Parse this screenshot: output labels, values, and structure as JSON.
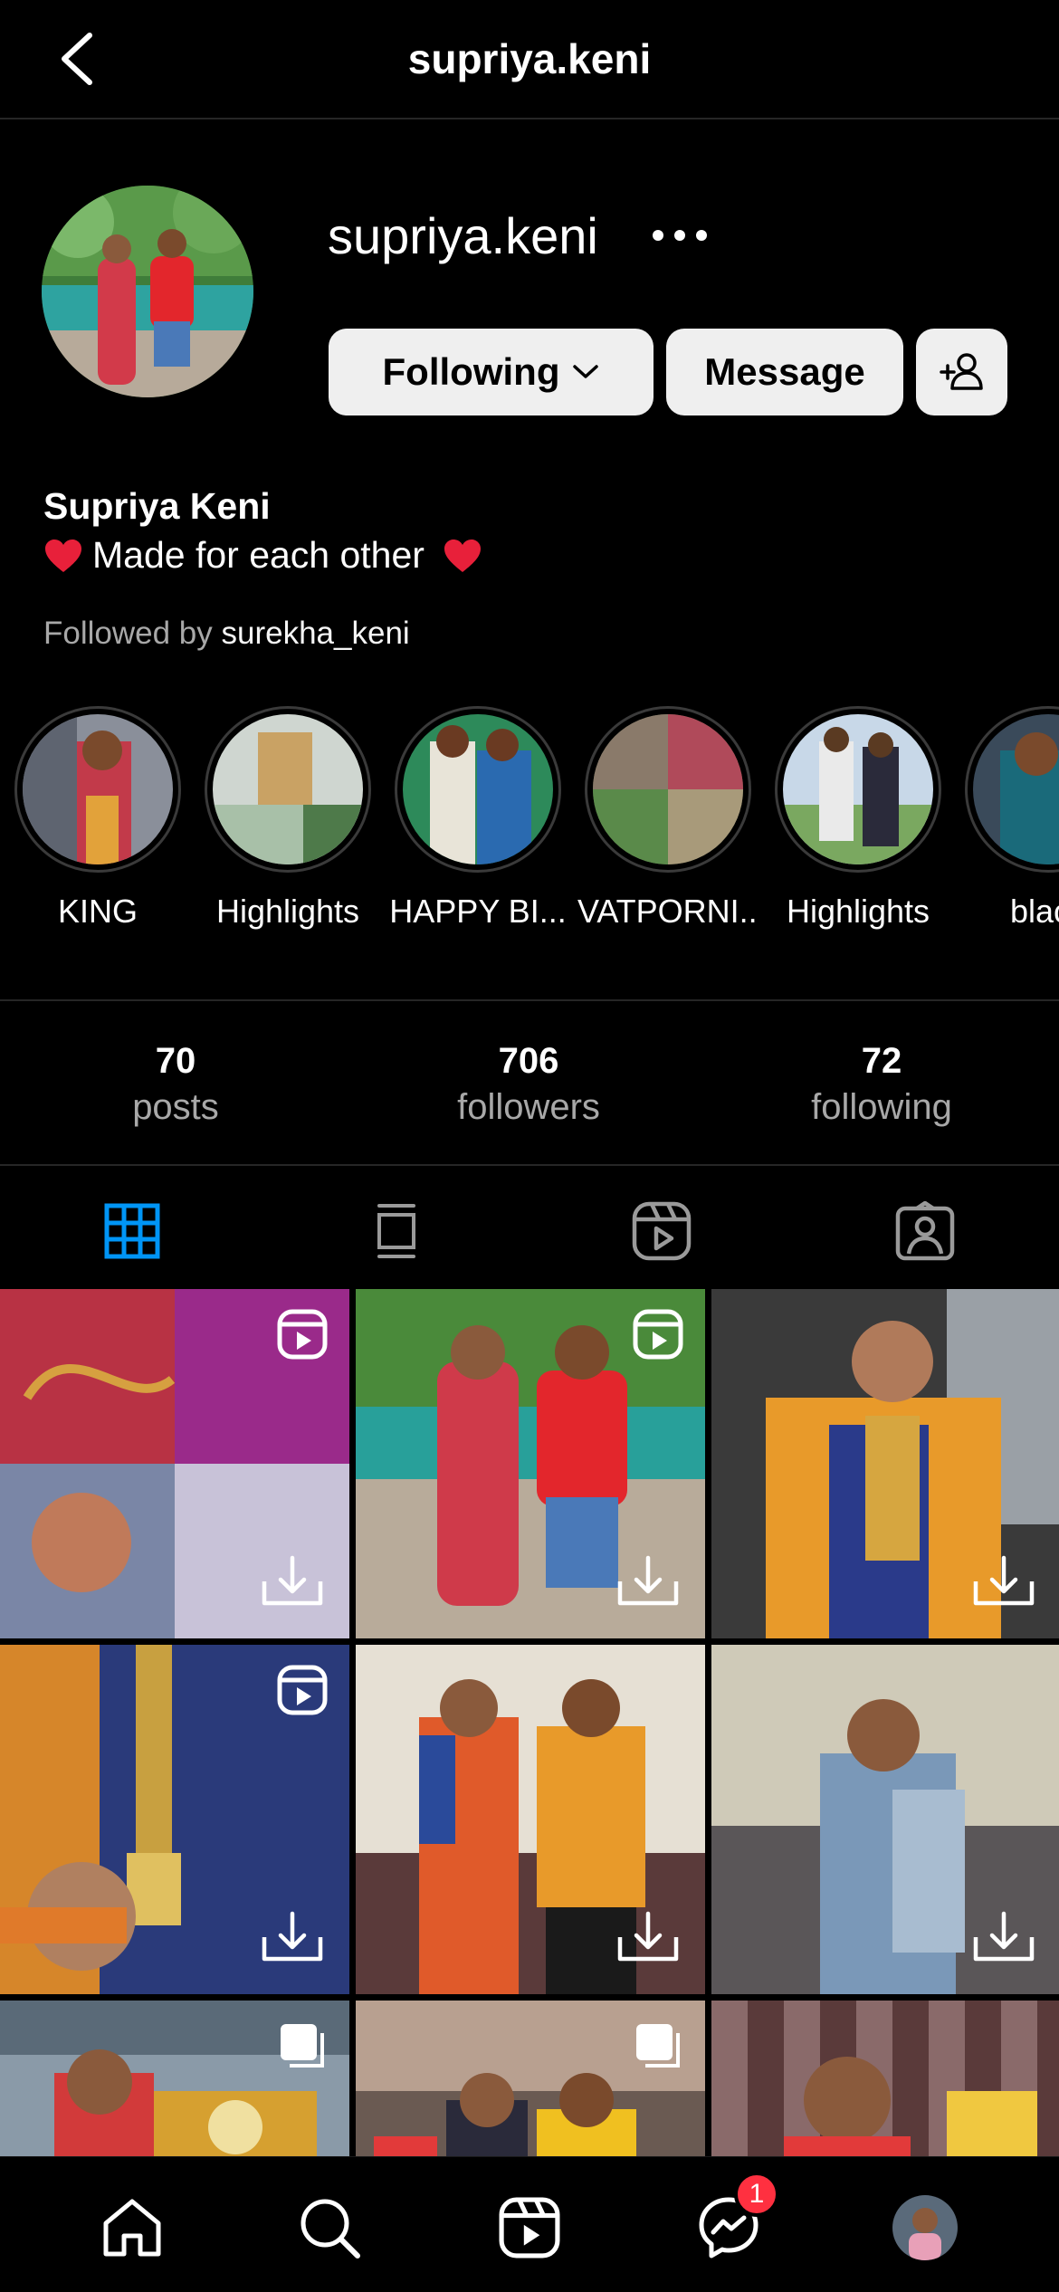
{
  "header": {
    "title": "supriya.keni",
    "back_icon": "chevron-left-icon"
  },
  "profile": {
    "username": "supriya.keni",
    "more_icon": "more-horizontal-icon",
    "full_name": "Supriya Keni",
    "bio_text": "Made for each other",
    "followed_by_prefix": "Followed by",
    "followed_by_user": "surekha_keni"
  },
  "actions": {
    "following_label": "Following",
    "message_label": "Message",
    "add_user_icon": "add-user-icon"
  },
  "highlights": [
    {
      "label": "KING"
    },
    {
      "label": "Highlights"
    },
    {
      "label": "HAPPY BI..."
    },
    {
      "label": "VATPORNI..."
    },
    {
      "label": "Highlights"
    },
    {
      "label": "black"
    }
  ],
  "stats": {
    "posts": {
      "value": "70",
      "label": "posts"
    },
    "followers": {
      "value": "706",
      "label": "followers"
    },
    "following": {
      "value": "72",
      "label": "following"
    }
  },
  "tabs": [
    "grid-icon",
    "feed-icon",
    "reels-icon",
    "tagged-icon"
  ],
  "nav": {
    "items": [
      "home-icon",
      "search-icon",
      "reels-icon",
      "messenger-icon",
      "profile-avatar"
    ],
    "messenger_badge": "1"
  },
  "colors": {
    "background": "#000000",
    "accent_blue": "#0095f6",
    "button_bg": "#efefef",
    "muted_text": "#a8a8a8",
    "heart_red": "#e8203a",
    "badge_red": "#ff3040"
  }
}
